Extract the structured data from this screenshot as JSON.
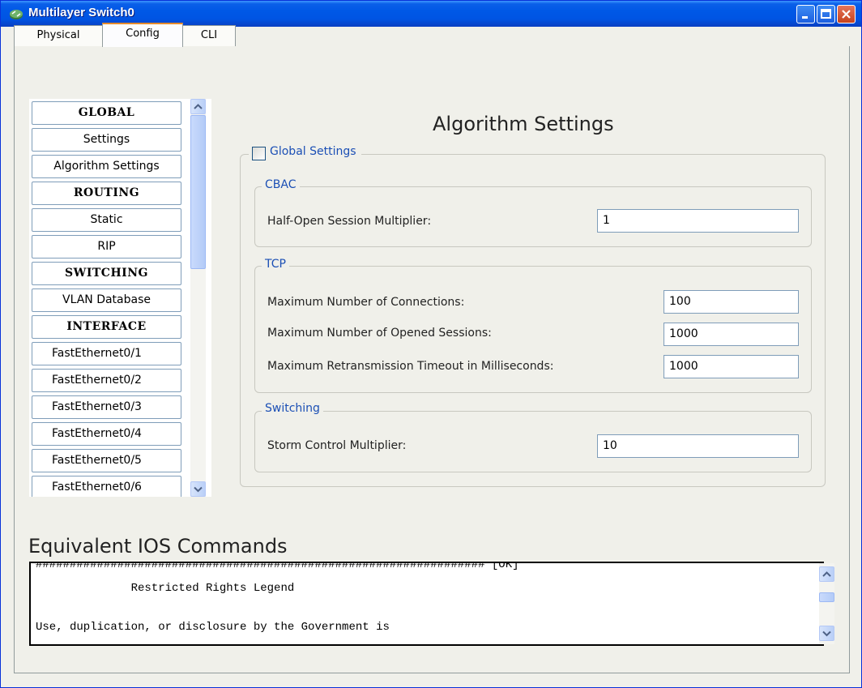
{
  "window": {
    "title": "Multilayer Switch0"
  },
  "tabs": [
    {
      "label": "Physical"
    },
    {
      "label": "Config"
    },
    {
      "label": "CLI"
    }
  ],
  "nav": {
    "items": [
      {
        "label": "GLOBAL",
        "type": "header"
      },
      {
        "label": "Settings",
        "type": "item"
      },
      {
        "label": "Algorithm Settings",
        "type": "item"
      },
      {
        "label": "ROUTING",
        "type": "header"
      },
      {
        "label": "Static",
        "type": "item"
      },
      {
        "label": "RIP",
        "type": "item"
      },
      {
        "label": "SWITCHING",
        "type": "header"
      },
      {
        "label": "VLAN Database",
        "type": "item"
      },
      {
        "label": "INTERFACE",
        "type": "header"
      },
      {
        "label": "FastEthernet0/1",
        "type": "item"
      },
      {
        "label": "FastEthernet0/2",
        "type": "item"
      },
      {
        "label": "FastEthernet0/3",
        "type": "item"
      },
      {
        "label": "FastEthernet0/4",
        "type": "item"
      },
      {
        "label": "FastEthernet0/5",
        "type": "item"
      },
      {
        "label": "FastEthernet0/6",
        "type": "item"
      }
    ]
  },
  "algorithm": {
    "title": "Algorithm Settings",
    "global_settings_label": "Global Settings",
    "global_settings_checked": false,
    "cbac": {
      "label": "CBAC",
      "half_open_label": "Half-Open Session Multiplier:",
      "half_open_value": "1"
    },
    "tcp": {
      "label": "TCP",
      "max_connections_label": "Maximum Number of Connections:",
      "max_connections_value": "100",
      "max_sessions_label": "Maximum Number of Opened Sessions:",
      "max_sessions_value": "1000",
      "max_retrans_label": "Maximum Retransmission Timeout in Milliseconds:",
      "max_retrans_value": "1000"
    },
    "switching": {
      "label": "Switching",
      "storm_label": "Storm Control Multiplier:",
      "storm_value": "10"
    }
  },
  "ios": {
    "title": "Equivalent IOS Commands",
    "lines": [
      "################################################################## [OK]",
      "              Restricted Rights Legend",
      "",
      "Use, duplication, or disclosure by the Government is"
    ]
  },
  "colors": {
    "titlebar": "#0054e3",
    "group_label": "#1b4fb5",
    "active_tab_accent": "#e68b2c"
  }
}
